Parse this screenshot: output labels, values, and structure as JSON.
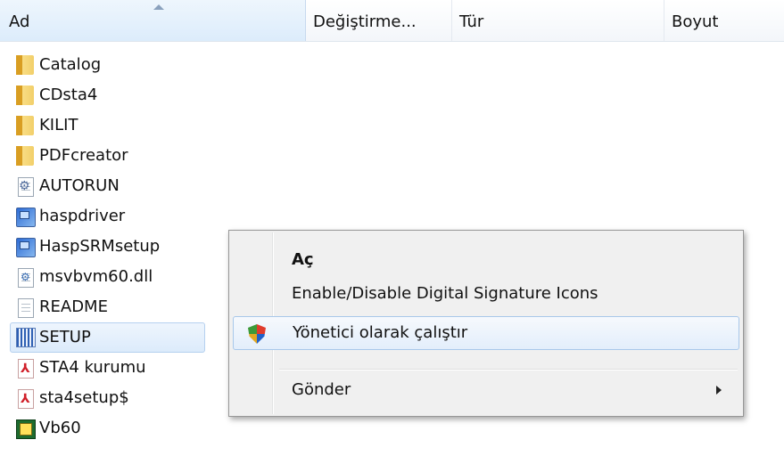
{
  "columns": {
    "name": "Ad",
    "modified": "Değiştirme...",
    "type": "Tür",
    "size": "Boyut"
  },
  "files": [
    {
      "name": "Catalog",
      "icon": "folder-icon"
    },
    {
      "name": "CDsta4",
      "icon": "folder-icon"
    },
    {
      "name": "KILIT",
      "icon": "folder-icon"
    },
    {
      "name": "PDFcreator",
      "icon": "folder-icon"
    },
    {
      "name": "AUTORUN",
      "icon": "settings-file-icon"
    },
    {
      "name": "haspdriver",
      "icon": "application-icon"
    },
    {
      "name": "HaspSRMsetup",
      "icon": "installer-icon"
    },
    {
      "name": "msvbvm60.dll",
      "icon": "dll-file-icon"
    },
    {
      "name": "README",
      "icon": "text-file-icon"
    },
    {
      "name": "SETUP",
      "icon": "setup-icon",
      "selected": true
    },
    {
      "name": "STA4 kurumu",
      "icon": "pdf-icon"
    },
    {
      "name": "sta4setup$",
      "icon": "pdf-icon"
    },
    {
      "name": "Vb60",
      "icon": "vb-application-icon"
    }
  ],
  "context_menu": {
    "open": "Aç",
    "signature": "Enable/Disable Digital Signature Icons",
    "run_as_admin": "Yönetici olarak çalıştır",
    "send_to": "Gönder"
  },
  "colors": {
    "selection_border": "#b5d0ef",
    "menu_background": "#f0f0f0",
    "menu_highlight_border": "#a8c8ea"
  }
}
